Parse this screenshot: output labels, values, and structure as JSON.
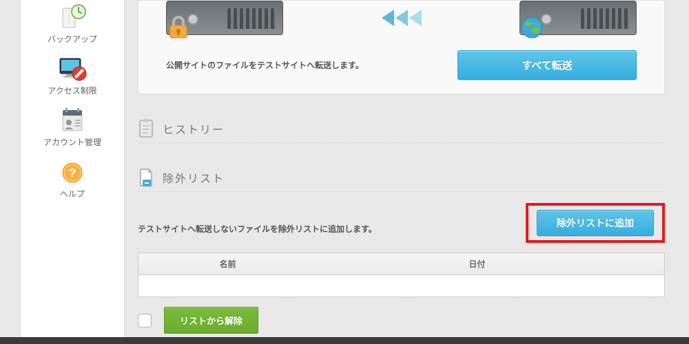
{
  "sidebar": {
    "items": [
      {
        "label": "バックアップ"
      },
      {
        "label": "アクセス制限"
      },
      {
        "label": "アカウント管理"
      },
      {
        "label": "ヘルプ"
      }
    ]
  },
  "transfer": {
    "caption": "公開サイトのファイルをテストサイトへ転送します。",
    "button": "すべて転送"
  },
  "history": {
    "title": "ヒストリー"
  },
  "exclude": {
    "title": "除外リスト",
    "description": "テストサイトへ転送しないファイルを除外リストに追加します。",
    "add_button": "除外リストに追加",
    "table": {
      "col_name": "名前",
      "col_date": "日付"
    },
    "remove_button": "リストから解除"
  }
}
